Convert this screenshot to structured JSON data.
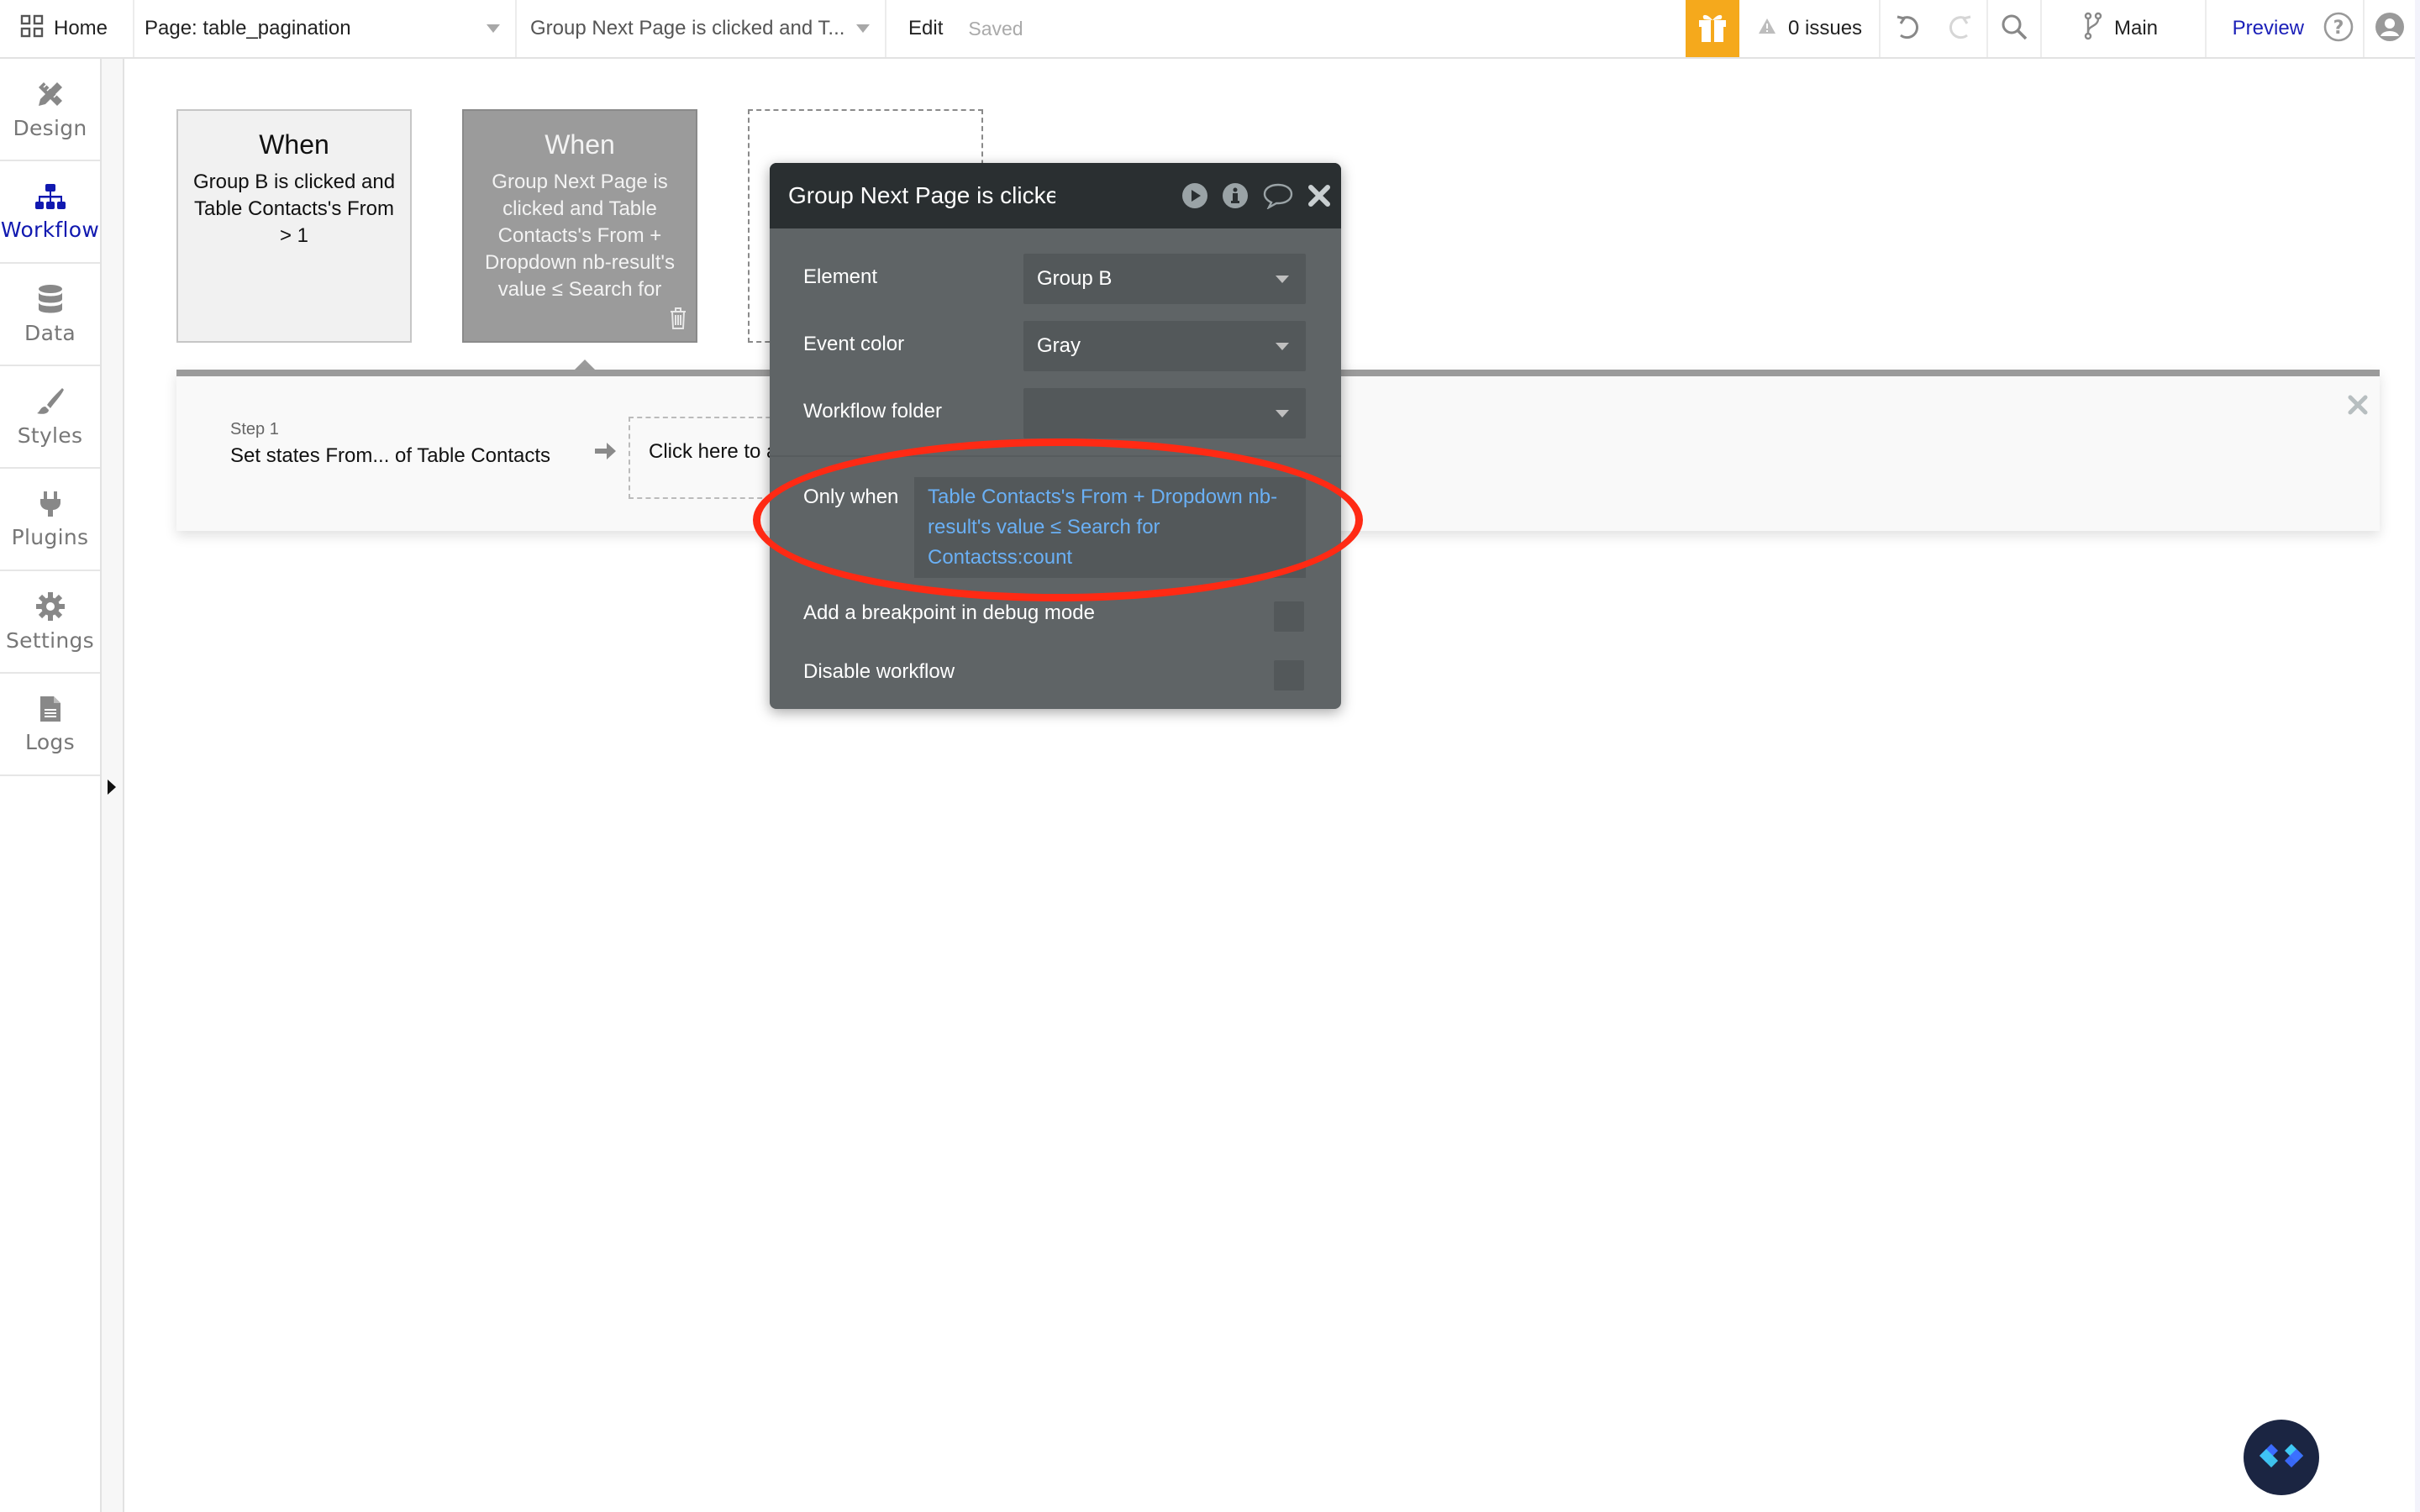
{
  "topbar": {
    "home_label": "Home",
    "page_selector": "Page: table_pagination",
    "workflow_selector": "Group Next Page is clicked and T...",
    "edit_label": "Edit",
    "save_status": "Saved",
    "issues_label": "0 issues",
    "branch_label": "Main",
    "preview_label": "Preview",
    "colors": {
      "gift": "#f5a91c",
      "preview": "#1a1fb8"
    }
  },
  "sidebar": {
    "items": [
      {
        "label": "Design",
        "icon": "design-icon",
        "active": false
      },
      {
        "label": "Workflow",
        "icon": "workflow-icon",
        "active": true
      },
      {
        "label": "Data",
        "icon": "database-icon",
        "active": false
      },
      {
        "label": "Styles",
        "icon": "brush-icon",
        "active": false
      },
      {
        "label": "Plugins",
        "icon": "plug-icon",
        "active": false
      },
      {
        "label": "Settings",
        "icon": "gear-icon",
        "active": false
      },
      {
        "label": "Logs",
        "icon": "document-icon",
        "active": false
      }
    ],
    "active_color": "#1119b0"
  },
  "events": [
    {
      "title": "When",
      "description": "Group B is clicked and Table Contacts's From > 1",
      "color": "Light"
    },
    {
      "title": "When",
      "description": "Group Next Page is clicked and Table Contacts's From + Dropdown nb-result's value ≤ Search for",
      "color": "Gray",
      "selected": true
    }
  ],
  "step_strip": {
    "step_number": "Step 1",
    "step_title": "Set states From... of Table Contacts",
    "add_action_label": "Click here to add an action..."
  },
  "popup": {
    "title": "Group Next Page is clicked",
    "fields": {
      "element": {
        "label": "Element",
        "value": "Group B"
      },
      "event_color": {
        "label": "Event color",
        "value": "Gray"
      },
      "workflow_folder": {
        "label": "Workflow folder",
        "value": ""
      },
      "only_when": {
        "label": "Only when",
        "value": "Table Contacts's From + Dropdown nb-result's value ≤ Search for Contactss:count"
      },
      "breakpoint": {
        "label": "Add a breakpoint in debug mode",
        "checked": false
      },
      "disable": {
        "label": "Disable workflow",
        "checked": false
      }
    },
    "expression_color": "#6ab0f5"
  },
  "annotation": {
    "type": "ellipse",
    "target": "only_when",
    "color": "#ff2a14"
  }
}
